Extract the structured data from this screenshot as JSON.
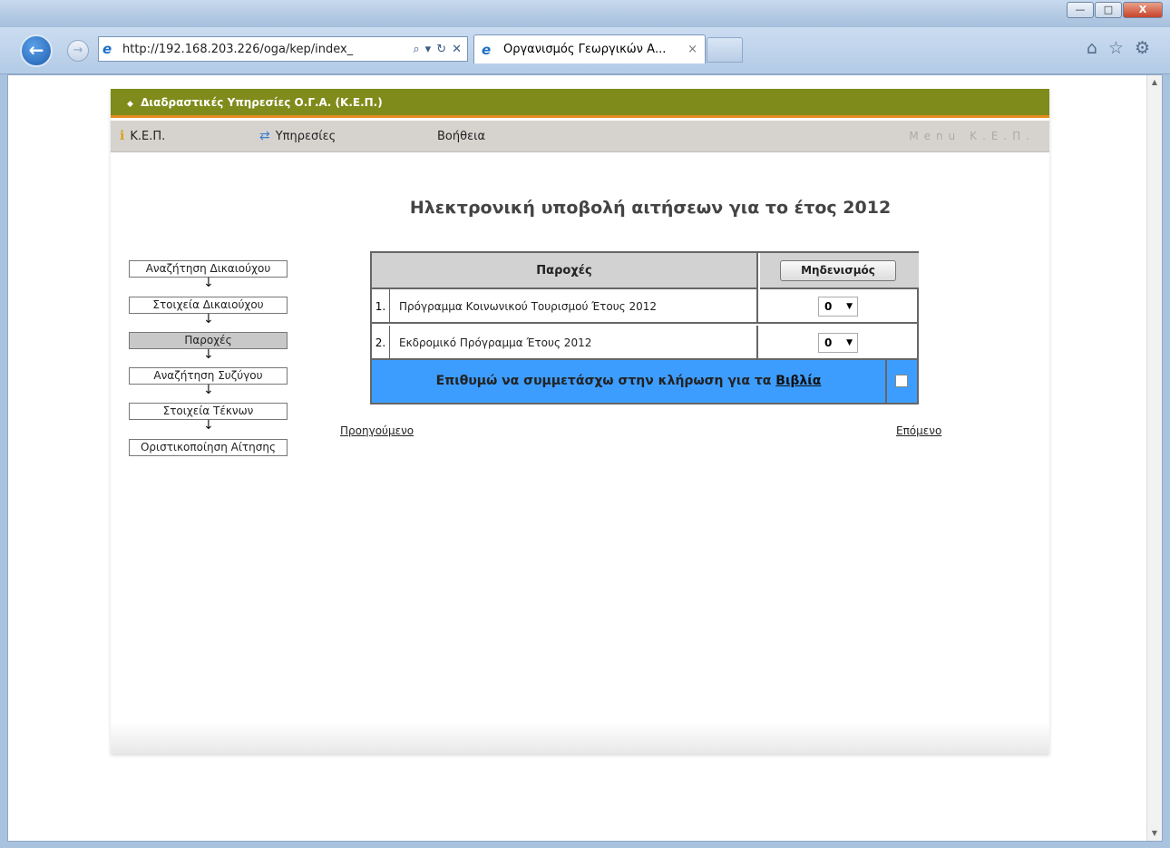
{
  "browser": {
    "address": "http://192.168.203.226/oga/kep/index_",
    "tab_title": "Οργανισμός Γεωργικών Α...",
    "tab_close": "×",
    "window_controls": {
      "minimize": "—",
      "maximize": "□",
      "close": "X"
    }
  },
  "site": {
    "header_title": "Διαδραστικές Υπηρεσίες Ο.Γ.Α. (Κ.Ε.Π.)",
    "menu": {
      "item1": "Κ.Ε.Π.",
      "item2": "Υπηρεσίες",
      "item3": "Βοήθεια",
      "brand": "Menu Κ.Ε.Π."
    }
  },
  "page": {
    "title": "Ηλεκτρονική υποβολή αιτήσεων για το έτος 2012",
    "steps": [
      "Αναζήτηση Δικαιούχου",
      "Στοιχεία Δικαιούχου",
      "Παροχές",
      "Αναζήτηση Συζύγου",
      "Στοιχεία Τέκνων",
      "Οριστικοποίηση Αίτησης"
    ],
    "active_step": 2,
    "table": {
      "header_label": "Παροχές",
      "reset_button": "Μηδενισμός",
      "rows": [
        {
          "num": "1.",
          "label": "Πρόγραμμα Κοινωνικού Τουρισμού Έτους 2012",
          "value": "0"
        },
        {
          "num": "2.",
          "label": "Εκδρομικό Πρόγραμμα Έτους 2012",
          "value": "0"
        }
      ],
      "lottery_text": "Επιθυμώ να συμμετάσχω στην κλήρωση για τα",
      "lottery_link": "Βιβλία",
      "lottery_checked": false
    },
    "prev_link": "Προηγούμενο",
    "next_link": "Επόμενο"
  },
  "colors": {
    "header_bg": "#7f8b1a",
    "header_accent": "#e68a1f",
    "lottery_bg": "#3d9dff",
    "active_step_bg": "#c8c8c8"
  }
}
